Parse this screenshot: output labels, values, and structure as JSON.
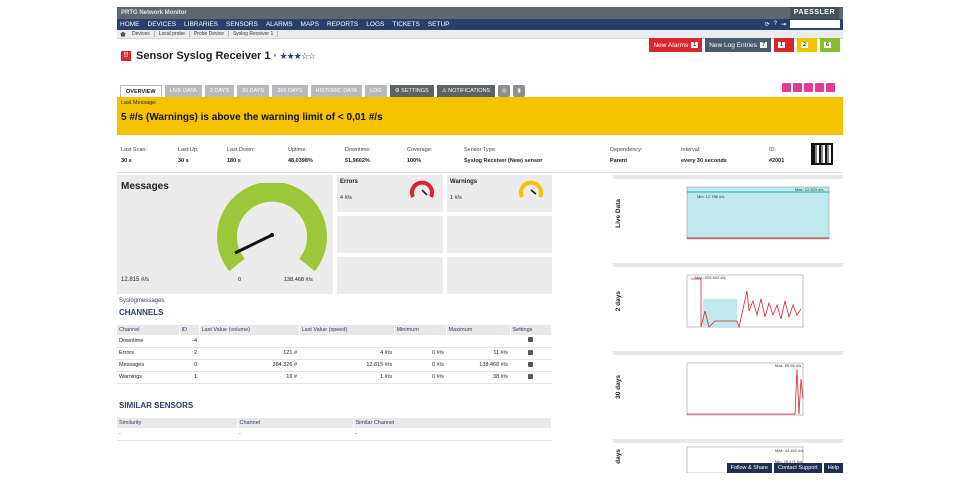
{
  "app": {
    "title": "PRTG Network Monitor",
    "brand": "PAESSLER"
  },
  "nav": {
    "items": [
      "HOME",
      "DEVICES",
      "LIBRARIES",
      "SENSORS",
      "ALARMS",
      "MAPS",
      "REPORTS",
      "LOGS",
      "TICKETS",
      "SETUP"
    ]
  },
  "breadcrumb": [
    "Devices",
    "Local probe",
    "Probe Device",
    "Syslog Receiver 1"
  ],
  "alerts": {
    "new_alarms_label": "New Alarms",
    "new_alarms_count": "1",
    "new_log_label": "New Log Entries",
    "new_log_count": "7",
    "red_count": "1",
    "yellow_count": "2",
    "green_count": "6"
  },
  "sensor": {
    "title": "Sensor Syslog Receiver 1",
    "stars": "★★★☆☆"
  },
  "tabs": [
    "OVERVIEW",
    "LIVE DATA",
    "2 DAYS",
    "30 DAYS",
    "365 DAYS",
    "HISTORIC DATA",
    "LOG"
  ],
  "tab_settings": "SETTINGS",
  "tab_notifications": "NOTIFICATIONS",
  "warning": {
    "label": "Last Message:",
    "message": "5 #/s (Warnings) is above the warning limit of < 0,01 #/s"
  },
  "stats": [
    {
      "label": "Last Scan:",
      "value": "30 s"
    },
    {
      "label": "Last Up:",
      "value": "30 s"
    },
    {
      "label": "Last Down:",
      "value": "180 s"
    },
    {
      "label": "Uptime:",
      "value": "48,0398%"
    },
    {
      "label": "Downtime:",
      "value": "51,9602%"
    },
    {
      "label": "Coverage:",
      "value": "100%"
    },
    {
      "label": "Sensor Type:",
      "value": "Syslog Receiver (New) sensor"
    },
    {
      "label": "Dependency:",
      "value": "Parent"
    },
    {
      "label": "Interval:",
      "value": "every 30 seconds"
    },
    {
      "label": "ID:",
      "value": "#2001"
    }
  ],
  "gauge": {
    "title": "Messages",
    "value": "12.815 #/s",
    "min": "0",
    "max": "138.468 #/s",
    "fill_fraction": 0.09
  },
  "mini_gauges": [
    {
      "title": "Errors",
      "value": "4 #/s",
      "color": "#d9262c"
    },
    {
      "title": "Warnings",
      "value": "1 #/s",
      "color": "#f5c200"
    }
  ],
  "link_syslog": "Syslogmessages",
  "channels": {
    "title": "CHANNELS",
    "headers": [
      "Channel",
      "ID",
      "Last Value (volume)",
      "Last Value (speed)",
      "Minimum",
      "Maximum",
      "Settings"
    ],
    "rows": [
      [
        "Downtime",
        "-4",
        "",
        "",
        "",
        "",
        ""
      ],
      [
        "Errors",
        "2",
        "121 #",
        "4 #/s",
        "0 #/s",
        "11 #/s",
        ""
      ],
      [
        "Messages",
        "0",
        "384.326 #",
        "12.815 #/s",
        "0 #/s",
        "138.468 #/s",
        ""
      ],
      [
        "Warnings",
        "1",
        "16 #",
        "1 #/s",
        "0 #/s",
        "38 #/s",
        ""
      ]
    ]
  },
  "similar": {
    "title": "SIMILAR SENSORS",
    "headers": [
      "Similarity",
      "Channel",
      "Similar Channel"
    ],
    "row": [
      "-",
      "-",
      "-"
    ]
  },
  "graphs": [
    {
      "label": "Live Data",
      "max": "Max: 12.823 #/s",
      "min": "Min: 12.786 #/s"
    },
    {
      "label": "2 days",
      "max": "Max: 525.542 #/s"
    },
    {
      "label": "30 days",
      "max": "Max: 85.66 #/s"
    },
    {
      "label": "days",
      "max": "Max: 44.402 #/s",
      "min": "Min: 20.471 #/s"
    }
  ],
  "footer": {
    "follow": "Follow & Share",
    "support": "Contact Support",
    "help": "Help"
  }
}
